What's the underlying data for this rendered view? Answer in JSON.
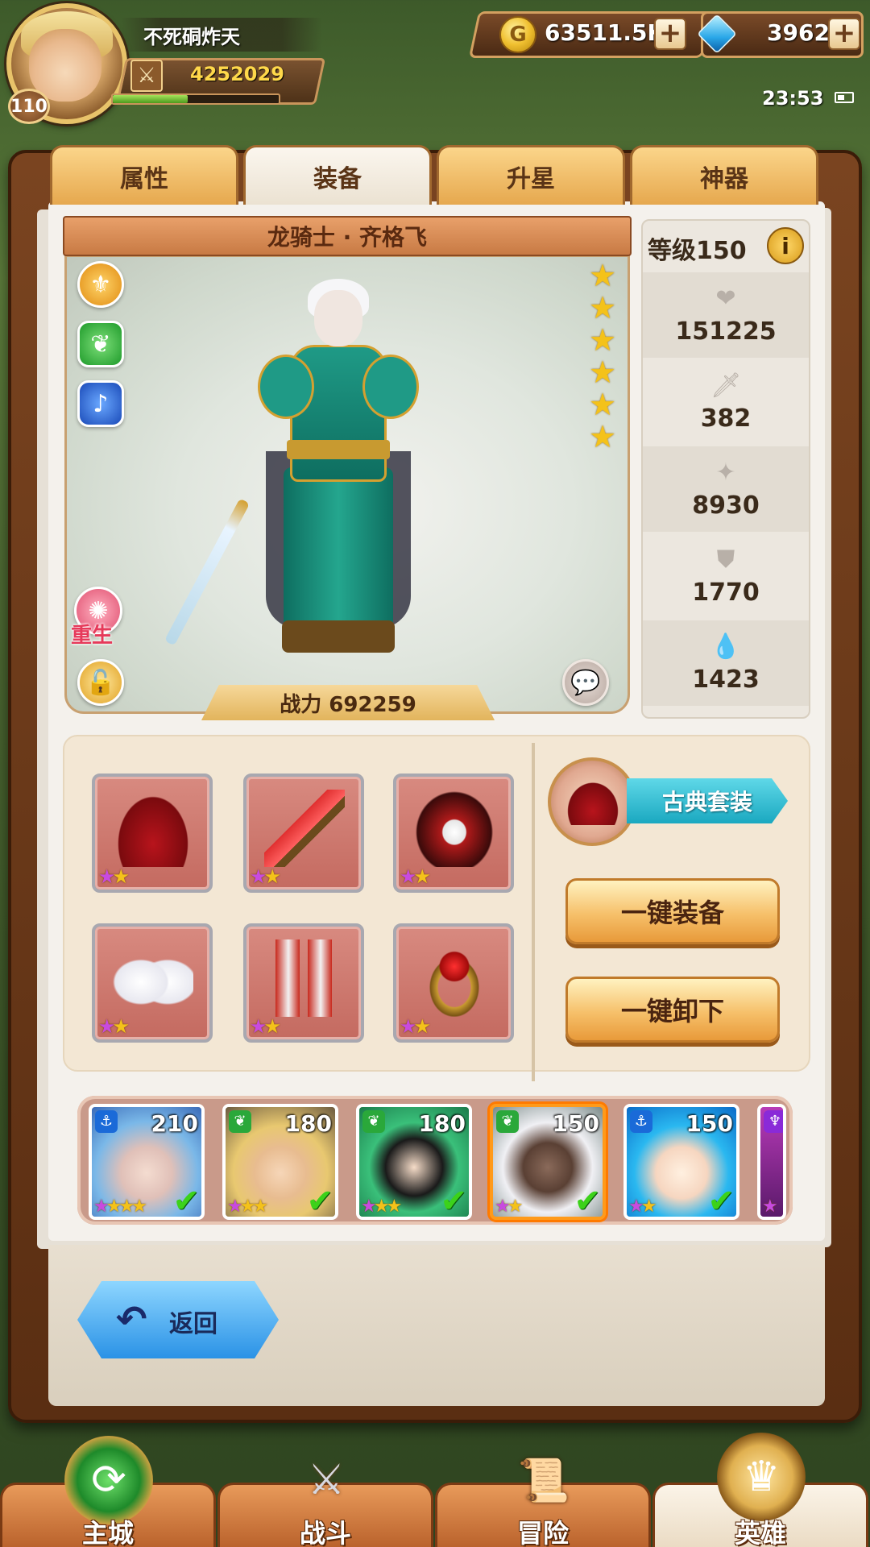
{
  "player": {
    "name": "不死硐炸天",
    "level": "110",
    "power": "4252029",
    "exp_fraction": 0.45
  },
  "currency": {
    "gold": "63511.5K",
    "gems": "3962"
  },
  "status": {
    "time": "23:53"
  },
  "tabs": [
    {
      "label": "属性"
    },
    {
      "label": "装备"
    },
    {
      "label": "升星"
    },
    {
      "label": "神器"
    }
  ],
  "hero": {
    "title": "龙骑士 · 齐格飞",
    "power_text": "战力 692259",
    "stars": 6,
    "rebirth_label": "重生"
  },
  "stats": {
    "level_text": "等级150",
    "hp": "151225",
    "attack": "382",
    "crit": "8930",
    "defense": "1770",
    "resist": "1423"
  },
  "equipment": {
    "slots": [
      {
        "icon": "hat-icon",
        "stars": 2
      },
      {
        "icon": "dagger-icon",
        "stars": 2
      },
      {
        "icon": "armor-icon",
        "stars": 2
      },
      {
        "icon": "gloves-icon",
        "stars": 2
      },
      {
        "icon": "boots-icon",
        "stars": 2
      },
      {
        "icon": "ring-icon",
        "stars": 2
      }
    ],
    "set_label": "古典套装",
    "equip_all": "一键装备",
    "unequip_all": "一键卸下"
  },
  "roster": [
    {
      "level": "210",
      "stars": 4,
      "faction": "anchor",
      "equipped": true
    },
    {
      "level": "180",
      "stars": 3,
      "faction": "beast",
      "equipped": true
    },
    {
      "level": "180",
      "stars": 3,
      "faction": "beast",
      "equipped": true
    },
    {
      "level": "150",
      "stars": 2,
      "faction": "beast",
      "equipped": true,
      "selected": true
    },
    {
      "level": "150",
      "stars": 2,
      "faction": "anchor",
      "equipped": true
    },
    {
      "level": "",
      "stars": 1,
      "faction": "demon",
      "equipped": false
    }
  ],
  "back": {
    "label": "返回"
  },
  "nav": [
    {
      "label": "主城"
    },
    {
      "label": "战斗"
    },
    {
      "label": "冒险"
    },
    {
      "label": "英雄"
    }
  ],
  "colors": {
    "accent_orange": "#e6a84e",
    "selected_border": "#ff9a1a",
    "set_teal": "#1aa8c0",
    "back_blue": "#2a92e6"
  }
}
